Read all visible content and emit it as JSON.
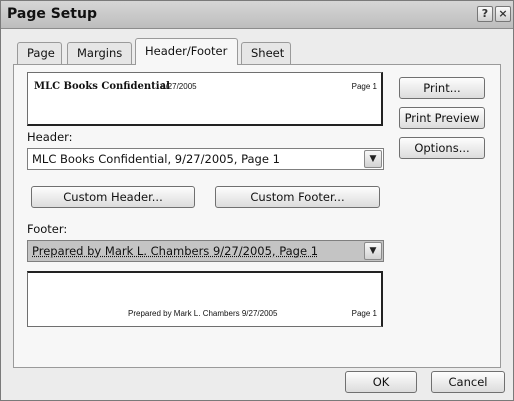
{
  "window": {
    "title": "Page Setup",
    "help_glyph": "?",
    "close_glyph": "×"
  },
  "tabs": [
    {
      "label": "Page"
    },
    {
      "label": "Margins"
    },
    {
      "label": "Header/Footer",
      "active": true
    },
    {
      "label": "Sheet"
    }
  ],
  "header_preview": {
    "left": "MLC Books Confidential",
    "center": "9/27/2005",
    "right": "Page 1"
  },
  "header_field": {
    "label": "Header:",
    "value": "MLC Books Confidential, 9/27/2005, Page 1"
  },
  "custom_buttons": {
    "header": "Custom Header...",
    "footer": "Custom Footer..."
  },
  "footer_field": {
    "label": "Footer:",
    "value": "Prepared by Mark L. Chambers 9/27/2005, Page 1"
  },
  "footer_preview": {
    "center": "Prepared by Mark L. Chambers 9/27/2005",
    "right": "Page 1"
  },
  "side_buttons": {
    "print": "Print...",
    "print_preview": "Print Preview",
    "options": "Options..."
  },
  "bottom_buttons": {
    "ok": "OK",
    "cancel": "Cancel"
  },
  "icons": {
    "dropdown": "chevron-down-icon",
    "help": "help-icon",
    "close": "close-icon"
  },
  "colors": {
    "dialog_bg": "#ececec",
    "panel_bg": "#f7f7f7",
    "selected_combo_bg": "#c4c4c4"
  }
}
